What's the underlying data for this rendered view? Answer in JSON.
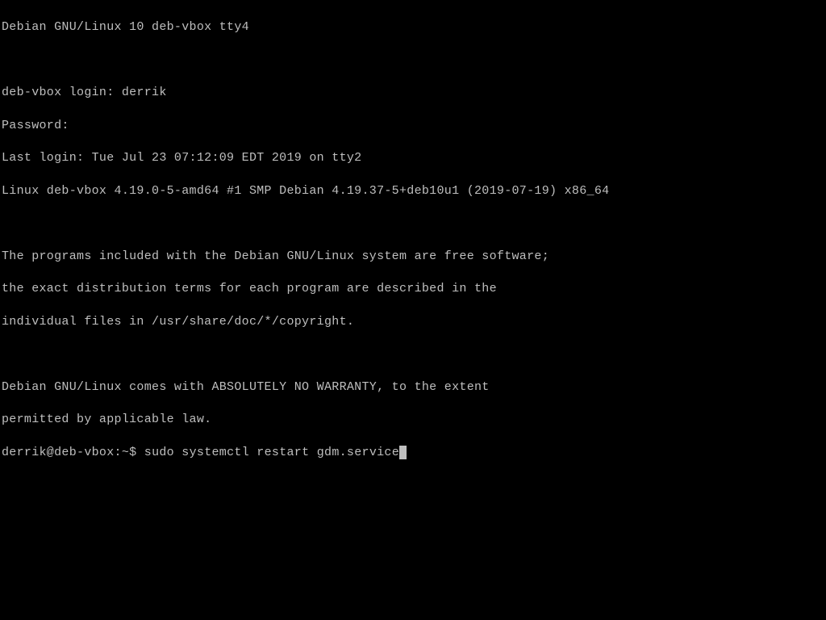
{
  "tty": {
    "banner": "Debian GNU/Linux 10 deb-vbox tty4",
    "login_prompt": "deb-vbox login: ",
    "username": "derrik",
    "password_prompt": "Password:",
    "last_login": "Last login: Tue Jul 23 07:12:09 EDT 2019 on tty2",
    "kernel_line": "Linux deb-vbox 4.19.0-5-amd64 #1 SMP Debian 4.19.37-5+deb10u1 (2019-07-19) x86_64",
    "motd_line1": "The programs included with the Debian GNU/Linux system are free software;",
    "motd_line2": "the exact distribution terms for each program are described in the",
    "motd_line3": "individual files in /usr/share/doc/*/copyright.",
    "motd_line4": "Debian GNU/Linux comes with ABSOLUTELY NO WARRANTY, to the extent",
    "motd_line5": "permitted by applicable law.",
    "prompt_user_host": "derrik@deb-vbox",
    "prompt_path": "~",
    "prompt_symbol": "$",
    "command": "sudo systemctl restart gdm.service"
  }
}
